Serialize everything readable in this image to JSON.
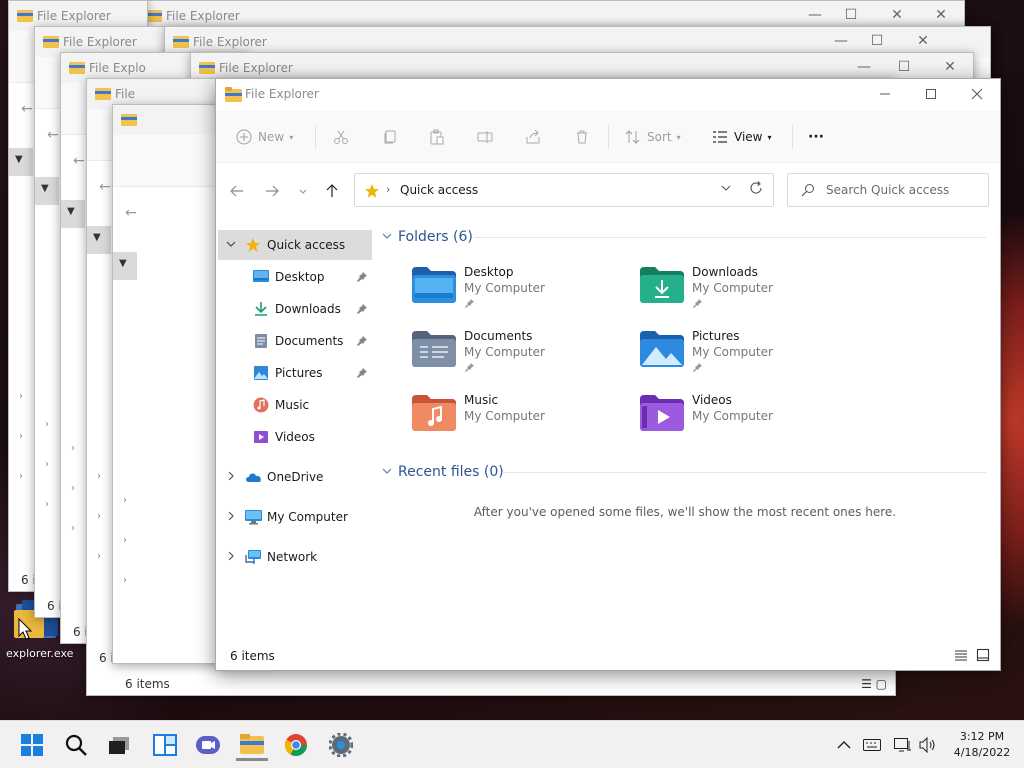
{
  "window": {
    "title": "File Explorer",
    "stacked_title_partial": "File Explo",
    "stacked_title_clip": "File",
    "stacked_count_clip": "6 i",
    "minimize_label": "—",
    "maximize_label": "☐",
    "close_label": "✕"
  },
  "commandbar": {
    "new_label": "New",
    "sort_label": "Sort",
    "view_label": "View",
    "more_label": "···"
  },
  "address": {
    "crumb_separator": "›",
    "location": "Quick access",
    "search_placeholder": "Search Quick access"
  },
  "nav": {
    "items": [
      {
        "label": "Quick access"
      },
      {
        "label": "Desktop"
      },
      {
        "label": "Downloads"
      },
      {
        "label": "Documents"
      },
      {
        "label": "Pictures"
      },
      {
        "label": "Music"
      },
      {
        "label": "Videos"
      },
      {
        "label": "OneDrive"
      },
      {
        "label": "My Computer"
      },
      {
        "label": "Network"
      }
    ]
  },
  "content": {
    "folders_header": "Folders (6)",
    "recent_header": "Recent files (0)",
    "empty_message": "After you've opened some files, we'll show the most recent ones here.",
    "folders": [
      {
        "name": "Desktop",
        "location": "My Computer"
      },
      {
        "name": "Downloads",
        "location": "My Computer"
      },
      {
        "name": "Documents",
        "location": "My Computer"
      },
      {
        "name": "Pictures",
        "location": "My Computer"
      },
      {
        "name": "Music",
        "location": "My Computer"
      },
      {
        "name": "Videos",
        "location": "My Computer"
      }
    ]
  },
  "status": {
    "count": "6 items"
  },
  "desktop": {
    "icon_label": "explorer.exe"
  },
  "taskbar": {
    "time": "3:12 PM",
    "date": "4/18/2022"
  },
  "colors": {
    "accent": "#0067c0",
    "folder_yellow": "#f2c14e",
    "header_blue": "#2b5694"
  }
}
